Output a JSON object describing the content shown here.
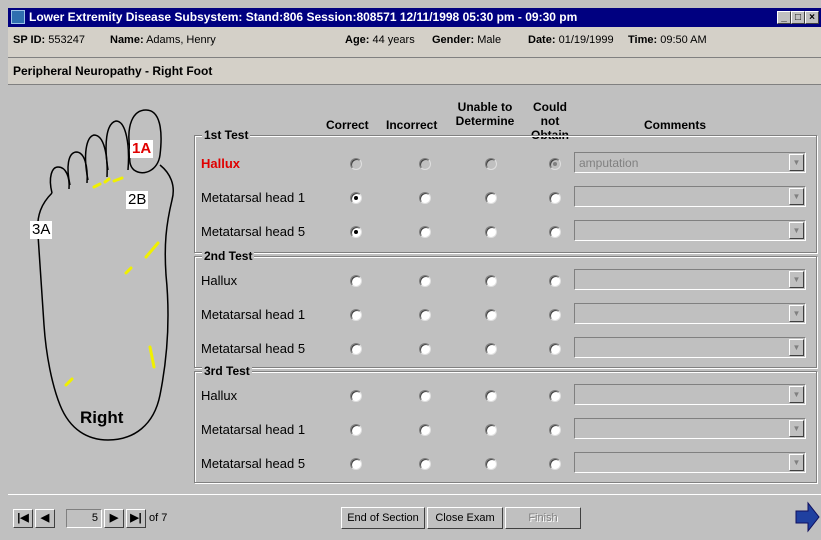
{
  "window": {
    "title": "Lower Extremity Disease Subsystem: Stand:806 Session:808571 12/11/1998 05:30 pm - 09:30 pm"
  },
  "info": {
    "sp_id_label": "SP ID:",
    "sp_id": "553247",
    "name_label": "Name:",
    "name": "Adams, Henry",
    "age_label": "Age:",
    "age": "44 years",
    "gender_label": "Gender:",
    "gender": "Male",
    "date_label": "Date:",
    "date": "01/19/1999",
    "time_label": "Time:",
    "time": "09:50 AM"
  },
  "section_title": "Peripheral Neuropathy - Right Foot",
  "foot": {
    "markers": [
      "1A",
      "2B",
      "3A"
    ],
    "side_label": "Right"
  },
  "columns": {
    "correct": "Correct",
    "incorrect": "Incorrect",
    "unable": "Unable to Determine",
    "could_not": "Could not Obtain",
    "comments": "Comments"
  },
  "tests": [
    {
      "title": "1st Test",
      "rows": [
        {
          "site": "Hallux",
          "selected": "could_not",
          "comment": "amputation"
        },
        {
          "site": "Metatarsal head 1",
          "selected": "correct",
          "comment": ""
        },
        {
          "site": "Metatarsal head 5",
          "selected": "correct",
          "comment": ""
        }
      ]
    },
    {
      "title": "2nd Test",
      "rows": [
        {
          "site": "Hallux",
          "selected": "",
          "comment": ""
        },
        {
          "site": "Metatarsal head 1",
          "selected": "",
          "comment": ""
        },
        {
          "site": "Metatarsal head 5",
          "selected": "",
          "comment": ""
        }
      ]
    },
    {
      "title": "3rd Test",
      "rows": [
        {
          "site": "Hallux",
          "selected": "",
          "comment": ""
        },
        {
          "site": "Metatarsal head 1",
          "selected": "",
          "comment": ""
        },
        {
          "site": "Metatarsal head 5",
          "selected": "",
          "comment": ""
        }
      ]
    }
  ],
  "pager": {
    "current": "5",
    "total_label": "of 7"
  },
  "buttons": {
    "end_of_section": "End of Section",
    "close_exam": "Close Exam",
    "finish": "Finish"
  },
  "colors": {
    "titlebar": "#000080",
    "highlight": "#e00000",
    "nerve_marks": "#f0f000"
  }
}
